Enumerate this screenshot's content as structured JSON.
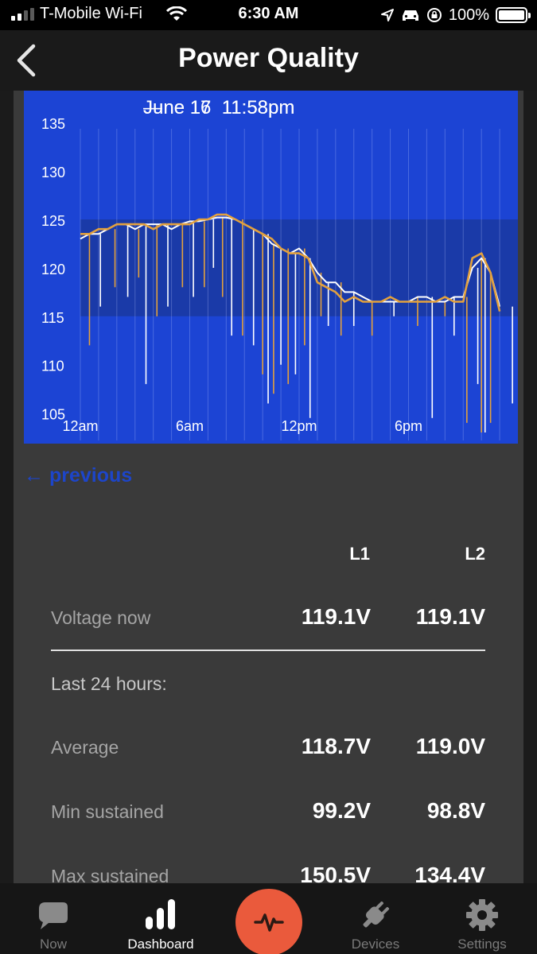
{
  "status_bar": {
    "carrier": "T-Mobile Wi-Fi",
    "time": "6:30 AM",
    "battery": "100%",
    "battery_level": 1.0,
    "icons": [
      "signal-icon",
      "wifi-icon",
      "location-icon",
      "car-icon",
      "rotation-lock-icon",
      "battery-icon"
    ]
  },
  "nav": {
    "title": "Power Quality",
    "back_icon": "chevron-left-icon"
  },
  "chart_range": {
    "start": "June 16  11:58pm",
    "separator": "—",
    "end": "June 17  11:58pm"
  },
  "chart_data": {
    "type": "line",
    "title": "",
    "xlabel": "",
    "ylabel": "",
    "x_unit": "hour",
    "xlim": [
      0,
      24
    ],
    "ylim": [
      103,
      136
    ],
    "yticks": [
      105,
      110,
      115,
      120,
      125,
      130,
      135
    ],
    "xticks": [
      {
        "value": 0,
        "label": "12am"
      },
      {
        "value": 6,
        "label": "6am"
      },
      {
        "value": 12,
        "label": "12pm"
      },
      {
        "value": 18,
        "label": "6pm"
      }
    ],
    "normal_band": [
      115,
      125
    ],
    "grid": "vertical hour lines",
    "colors": {
      "background": "#1c44d4",
      "band": "#1a3aa8",
      "L1": "#ffffff",
      "L2": "#e3a13d"
    },
    "series": [
      {
        "name": "",
        "color": "#ffffff",
        "x": [
          0,
          0.5,
          1,
          1.5,
          2,
          2.5,
          3,
          3.5,
          4,
          4.5,
          5,
          5.5,
          6,
          6.5,
          7,
          7.5,
          8,
          8.5,
          9,
          9.5,
          10,
          10.5,
          11,
          11.5,
          12,
          12.5,
          13,
          13.5,
          14,
          14.5,
          15,
          15.5,
          16,
          16.5,
          17,
          17.5,
          18,
          18.5,
          19,
          19.5,
          20,
          20.5,
          21,
          21.5,
          22,
          22.5,
          23
        ],
        "values": [
          123,
          123.5,
          123.5,
          124,
          124.5,
          124.5,
          124,
          124.5,
          124.5,
          124.5,
          124,
          124.5,
          124.8,
          124.8,
          125,
          125.2,
          125.2,
          125,
          124.5,
          124,
          123.5,
          122.5,
          122,
          121.5,
          122,
          121,
          119.5,
          118.5,
          118.5,
          117.5,
          117.5,
          117,
          116.5,
          116.5,
          116.5,
          116.5,
          116.5,
          117,
          117,
          116.5,
          116.5,
          117,
          117,
          120,
          121,
          119.5,
          116
        ]
      },
      {
        "name": "",
        "color": "#e3a13d",
        "x": [
          0,
          0.5,
          1,
          1.5,
          2,
          2.5,
          3,
          3.5,
          4,
          4.5,
          5,
          5.5,
          6,
          6.5,
          7,
          7.5,
          8,
          8.5,
          9,
          9.5,
          10,
          10.5,
          11,
          11.5,
          12,
          12.5,
          13,
          13.5,
          14,
          14.5,
          15,
          15.5,
          16,
          16.5,
          17,
          17.5,
          18,
          18.5,
          19,
          19.5,
          20,
          20.5,
          21,
          21.5,
          22,
          22.5,
          23
        ],
        "values": [
          123.5,
          123.5,
          124,
          124,
          124.5,
          124.5,
          124.5,
          124.5,
          124,
          124.5,
          124.5,
          124.5,
          124.5,
          125,
          125,
          125.5,
          125.5,
          125,
          124.5,
          124,
          123.5,
          123,
          122,
          121.5,
          121.5,
          121,
          118.5,
          118,
          117.5,
          116.5,
          117,
          116.5,
          116.5,
          116.5,
          117,
          116.5,
          116.5,
          116.5,
          116.5,
          116.5,
          117,
          116.5,
          116.5,
          121,
          121.5,
          119.5,
          115.5
        ]
      }
    ],
    "dips": [
      {
        "x": 0.5,
        "y": 112
      },
      {
        "x": 1.1,
        "y": 116
      },
      {
        "x": 1.9,
        "y": 118
      },
      {
        "x": 2.6,
        "y": 117
      },
      {
        "x": 3.2,
        "y": 119
      },
      {
        "x": 3.6,
        "y": 108
      },
      {
        "x": 4.2,
        "y": 115
      },
      {
        "x": 4.8,
        "y": 116
      },
      {
        "x": 5.6,
        "y": 118
      },
      {
        "x": 6.2,
        "y": 117
      },
      {
        "x": 6.8,
        "y": 118
      },
      {
        "x": 7.3,
        "y": 120
      },
      {
        "x": 7.8,
        "y": 117
      },
      {
        "x": 8.3,
        "y": 113
      },
      {
        "x": 8.9,
        "y": 113
      },
      {
        "x": 9.5,
        "y": 112
      },
      {
        "x": 10.0,
        "y": 109
      },
      {
        "x": 10.3,
        "y": 106
      },
      {
        "x": 10.6,
        "y": 107
      },
      {
        "x": 11.0,
        "y": 110
      },
      {
        "x": 11.4,
        "y": 108
      },
      {
        "x": 11.8,
        "y": 109
      },
      {
        "x": 12.3,
        "y": 112
      },
      {
        "x": 12.6,
        "y": 104.5
      },
      {
        "x": 13.2,
        "y": 115
      },
      {
        "x": 13.6,
        "y": 114
      },
      {
        "x": 14.3,
        "y": 113
      },
      {
        "x": 15.0,
        "y": 114
      },
      {
        "x": 16.0,
        "y": 113
      },
      {
        "x": 17.2,
        "y": 115
      },
      {
        "x": 18.5,
        "y": 114
      },
      {
        "x": 19.3,
        "y": 104.5
      },
      {
        "x": 20.0,
        "y": 115
      },
      {
        "x": 20.5,
        "y": 113
      },
      {
        "x": 21.2,
        "y": 104
      },
      {
        "x": 21.8,
        "y": 108
      },
      {
        "x": 22.0,
        "y": 103
      },
      {
        "x": 22.2,
        "y": 103
      },
      {
        "x": 22.5,
        "y": 104
      },
      {
        "x": 23.7,
        "y": 106
      }
    ]
  },
  "previous": {
    "arrow": "←",
    "label": "previous"
  },
  "table": {
    "col_l1": "L1",
    "col_l2": "L2",
    "voltage_now": {
      "label": "Voltage now",
      "l1": "119.1V",
      "l2": "119.1V"
    },
    "last24_label": "Last 24 hours:",
    "average": {
      "label": "Average",
      "l1": "118.7V",
      "l2": "119.0V"
    },
    "min_sustained": {
      "label": "Min sustained",
      "l1": "99.2V",
      "l2": "98.8V"
    },
    "max_sustained": {
      "label": "Max sustained",
      "l1": "150.5V",
      "l2": "134.4V"
    }
  },
  "tabs": [
    {
      "label": "Now",
      "icon": "speech-bubble-icon",
      "active": false
    },
    {
      "label": "Dashboard",
      "icon": "bar-chart-icon",
      "active": true
    },
    {
      "label": "Devices",
      "icon": "plug-icon",
      "active": false
    },
    {
      "label": "Settings",
      "icon": "gear-icon",
      "active": false
    }
  ],
  "center_button_icon": "pulse-icon"
}
